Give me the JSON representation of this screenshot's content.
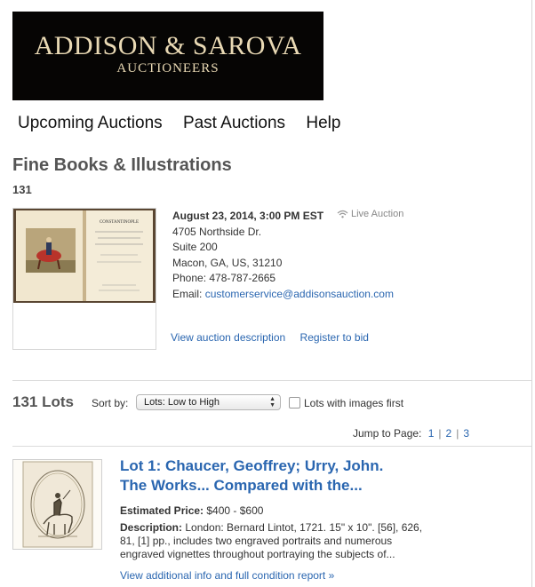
{
  "logo": {
    "name": "ADDISON & SAROVA",
    "subtitle": "AUCTIONEERS"
  },
  "nav": {
    "items": [
      "Upcoming Auctions",
      "Past Auctions",
      "Help"
    ]
  },
  "auction": {
    "title": "Fine Books & Illustrations",
    "sale_number": "131",
    "image_title": "CONSTANTINOPLE",
    "date": "August 23, 2014, 3:00 PM EST",
    "live_label": "Live Auction",
    "address_line1": "4705 Northside Dr.",
    "address_line2": "Suite 200",
    "address_line3": "Macon, GA, US, 31210",
    "phone": "Phone: 478-787-2665",
    "email_label": "Email: ",
    "email": "customerservice@addisonsauction.com",
    "view_description": "View auction description",
    "register": "Register to bid"
  },
  "lots": {
    "count_label": "131 Lots",
    "sort_label": "Sort by:",
    "sort_value": "Lots: Low to High",
    "images_first_label": "Lots with images first",
    "images_first_checked": false,
    "jump_label": "Jump to Page:",
    "pages": [
      "1",
      "2",
      "3"
    ]
  },
  "lot1": {
    "title_line1": "Lot 1: Chaucer, Geoffrey; Urry, John.",
    "title_line2": "The Works... Compared with the...",
    "price_label": "Estimated Price:",
    "price_value": " $400 - $600",
    "desc_label": "Description:",
    "desc_text": " London: Bernard Lintot, 1721. 15\" x 10\". [56], 626, 81, [1] pp., includes two engraved portraits and numerous engraved vignettes throughout portraying the subjects of...",
    "more_link": "View additional info and full condition report »"
  },
  "colors": {
    "link": "#2a66b0",
    "heading": "#555555",
    "logo_bg": "#060504",
    "logo_text": "#e9d9b4"
  }
}
